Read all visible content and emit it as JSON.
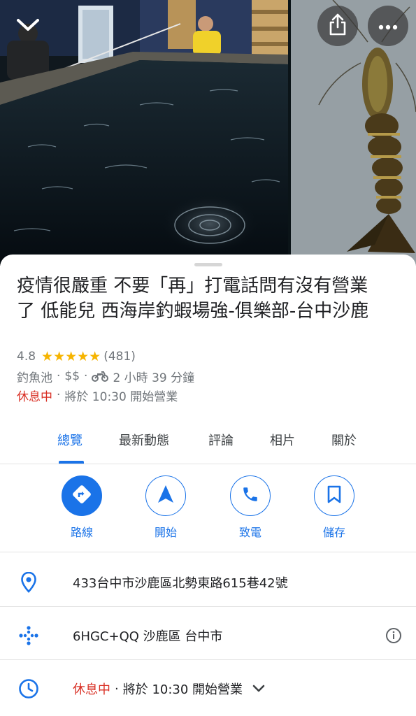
{
  "header": {
    "back_icon": "chevron-down-icon",
    "share_icon": "share-icon",
    "more_icon": "more-horizontal-icon"
  },
  "place": {
    "title": "疫情很嚴重 不要「再」打電話問有沒有營業了 低能兒 西海岸釣蝦場強-俱樂部-台中沙鹿",
    "rating": "4.8",
    "stars": "★★★★★",
    "review_count": "(481)",
    "category": "釣魚池",
    "price": "$$",
    "travel_mode_icon": "motorcycle-icon",
    "travel_time": "2 小時 39 分鐘",
    "status": "休息中",
    "next_open": "將於 10:30 開始營業",
    "separator": "·"
  },
  "tabs": [
    {
      "label": "總覽",
      "active": true
    },
    {
      "label": "最新動態",
      "active": false
    },
    {
      "label": "評論",
      "active": false
    },
    {
      "label": "相片",
      "active": false
    },
    {
      "label": "關於",
      "active": false
    }
  ],
  "actions": [
    {
      "label": "路線",
      "icon": "directions-icon"
    },
    {
      "label": "開始",
      "icon": "navigation-arrow-icon"
    },
    {
      "label": "致電",
      "icon": "phone-icon"
    },
    {
      "label": "儲存",
      "icon": "bookmark-icon"
    }
  ],
  "info": {
    "address": "433台中市沙鹿區北勢東路615巷42號",
    "plus_code": "6HGC+QQ 沙鹿區 台中市",
    "hours_status": "休息中",
    "hours_next": "將於 10:30 開始營業"
  },
  "colors": {
    "accent": "#1a73e8",
    "closed": "#d93025",
    "star": "#f6b400",
    "secondary_text": "#70757a"
  }
}
